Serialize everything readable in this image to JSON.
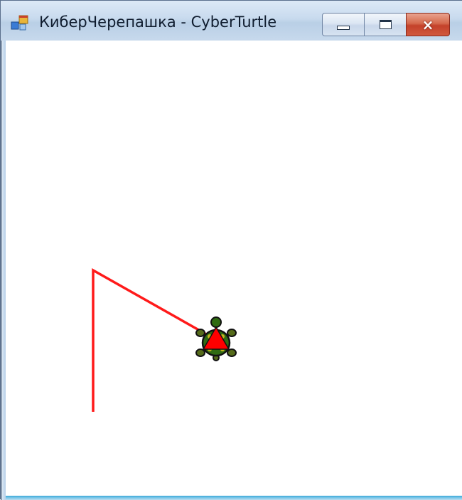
{
  "window": {
    "title": "КиберЧерепашка - CyberTurtle"
  },
  "controls": {
    "minimize": "minimize",
    "maximize": "maximize",
    "close": "×"
  },
  "icons": {
    "app": "app-window-icon",
    "minimize": "minimize-icon",
    "maximize": "maximize-icon",
    "close": "close-icon",
    "turtle": "turtle-icon"
  },
  "drawing": {
    "pen_color": "#ff1a1a",
    "heading_color": "#ff0000",
    "turtle_shell": "#2f6b12",
    "turtle_limbs": "#556b1a"
  }
}
